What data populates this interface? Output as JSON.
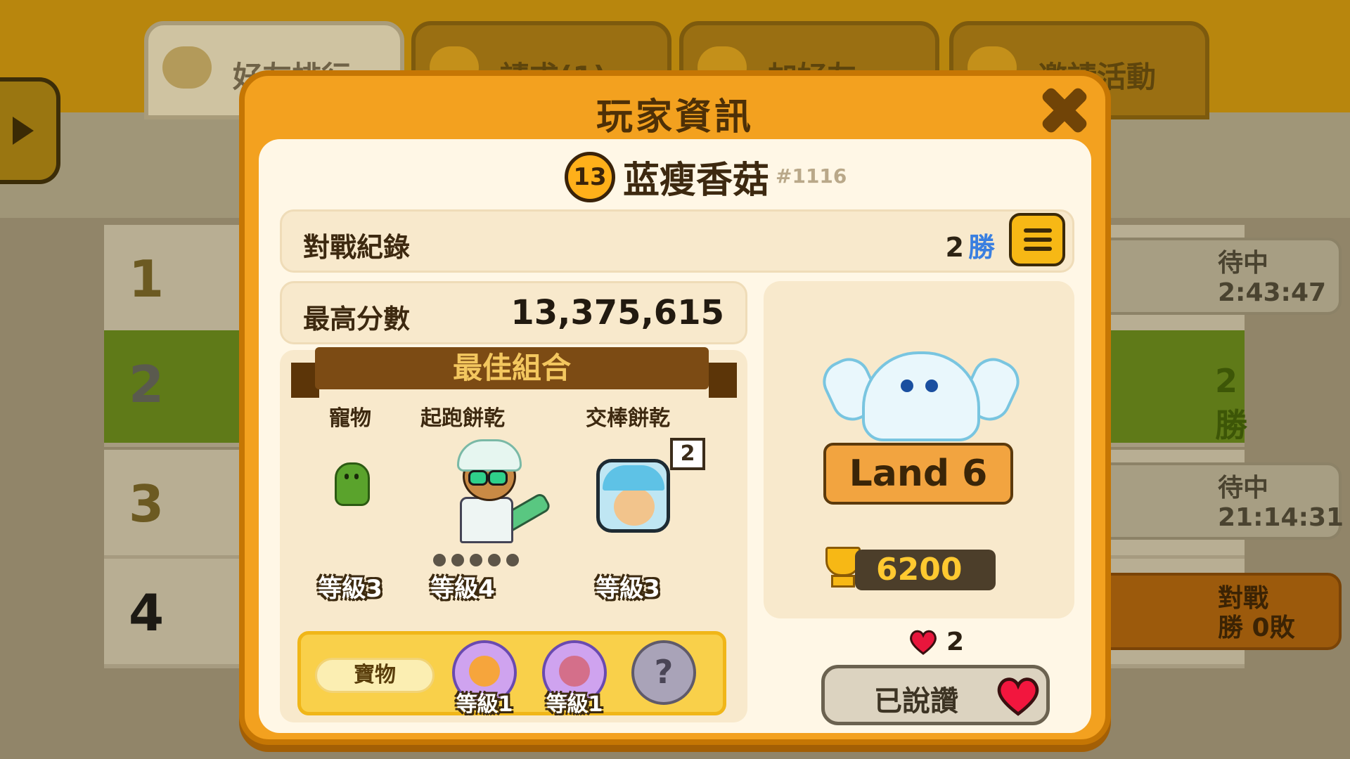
{
  "background": {
    "tabs": [
      {
        "label": "好友排行"
      },
      {
        "label": "請求(1)"
      },
      {
        "label": "加好友"
      },
      {
        "label": "邀請活動"
      }
    ],
    "rows": [
      {
        "rank": "1",
        "status": "待中",
        "timer": "2:43:47"
      },
      {
        "rank": "2",
        "status": "2勝"
      },
      {
        "rank": "3",
        "status": "待中",
        "timer": "21:14:31"
      },
      {
        "rank": "4",
        "status": "對戰",
        "record": "勝 0敗"
      }
    ]
  },
  "dialog": {
    "title": "玩家資訊",
    "player": {
      "level": "13",
      "name": "蓝瘦香菇",
      "tag": "#1116"
    },
    "battle_record": {
      "label": "對戰紀錄",
      "wins": "2",
      "wins_unit": "勝"
    },
    "best_score": {
      "label": "最高分數",
      "value": "13,375,615"
    },
    "best_combo": {
      "title": "最佳組合",
      "pet": {
        "label": "寵物",
        "level": "等級3"
      },
      "runner": {
        "label": "起跑餅乾",
        "level": "等級4"
      },
      "relay": {
        "label": "交棒餅乾",
        "level": "等級3",
        "badge": "2"
      },
      "treasures": {
        "label": "寶物",
        "items": [
          {
            "level": "等級1"
          },
          {
            "level": "等級1"
          },
          {
            "symbol": "?"
          }
        ]
      }
    },
    "land": {
      "label": "Land 6",
      "trophies": "6200"
    },
    "likes": {
      "count": "2",
      "button_label": "已說讚"
    }
  },
  "colors": {
    "dialog_orange": "#f3a11f",
    "panel_cream": "#fff7e6",
    "banner_brown": "#7c4b14",
    "wins_blue": "#3a7fe0",
    "heart_red": "#e8163c"
  }
}
